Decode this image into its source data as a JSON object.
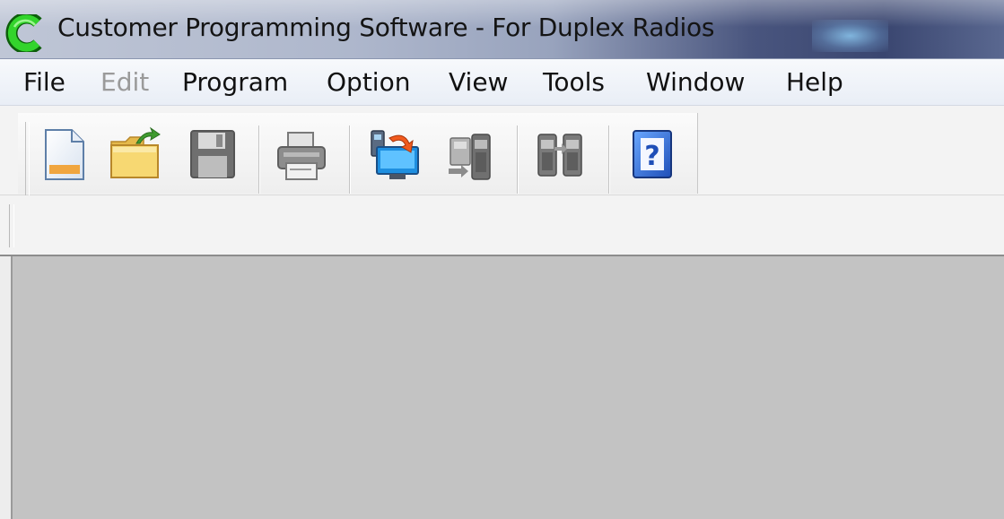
{
  "window": {
    "title": "Customer Programming Software - For Duplex Radios",
    "icon": "app-c-logo-icon"
  },
  "menu": {
    "items": [
      {
        "label": "File",
        "enabled": true
      },
      {
        "label": "Edit",
        "enabled": false
      },
      {
        "label": "Program",
        "enabled": true
      },
      {
        "label": "Option",
        "enabled": true
      },
      {
        "label": "View",
        "enabled": true
      },
      {
        "label": "Tools",
        "enabled": true
      },
      {
        "label": "Window",
        "enabled": true
      },
      {
        "label": "Help",
        "enabled": true
      }
    ]
  },
  "toolbar": {
    "buttons": [
      {
        "icon": "new-file-icon",
        "enabled": true
      },
      {
        "icon": "open-folder-icon",
        "enabled": true
      },
      {
        "icon": "save-icon",
        "enabled": false
      },
      {
        "icon": "print-icon",
        "enabled": false
      },
      {
        "icon": "read-from-radio-icon",
        "enabled": true
      },
      {
        "icon": "write-to-radio-icon",
        "enabled": false
      },
      {
        "icon": "clone-radio-icon",
        "enabled": false
      },
      {
        "icon": "help-icon",
        "enabled": true
      }
    ]
  },
  "colors": {
    "workspace": "#c3c3c3",
    "menubar": "#e9eef6",
    "app_icon_green": "#22c21e",
    "help_blue": "#2d6fd6"
  }
}
